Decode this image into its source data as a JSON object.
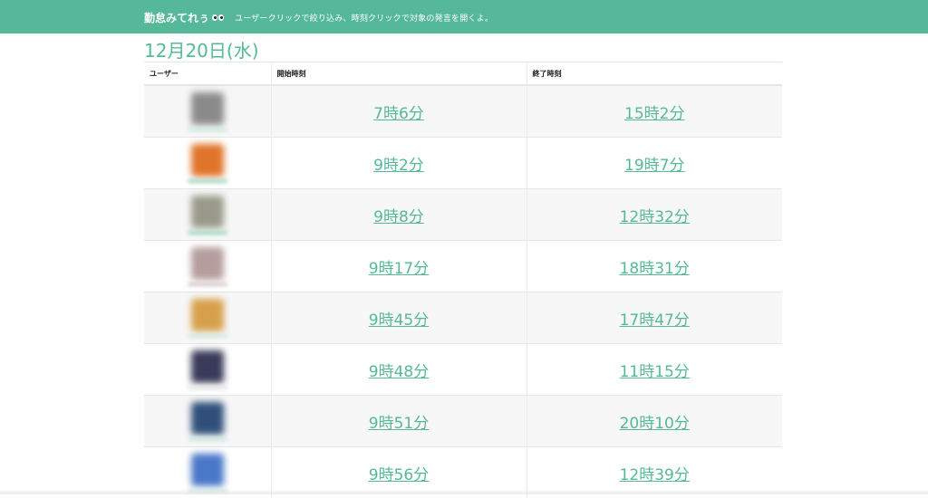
{
  "header": {
    "brand": "勤怠みてれぅ",
    "hint": "ユーザークリックで絞り込み、時刻クリックで対象の発言を開くよ。",
    "color": "#55b999"
  },
  "date_heading": "12月20日(水)",
  "table": {
    "columns": [
      "ユーザー",
      "開始時刻",
      "終了時刻"
    ],
    "rows": [
      {
        "avatar_color": "#8a8a8a",
        "label_color": "#cfe9df",
        "start": "7時6分",
        "end": "15時2分"
      },
      {
        "avatar_color": "#e0742a",
        "label_color": "#9fd9c1",
        "start": "9時2分",
        "end": "19時7分"
      },
      {
        "avatar_color": "#9a9a8a",
        "label_color": "#9fd9c1",
        "start": "9時8分",
        "end": "12時32分"
      },
      {
        "avatar_color": "#b59d9d",
        "label_color": "#d9c9c9",
        "start": "9時17分",
        "end": "18時31分"
      },
      {
        "avatar_color": "#d6a04a",
        "label_color": "#cfe9df",
        "start": "9時45分",
        "end": "17時47分"
      },
      {
        "avatar_color": "#3a3a5a",
        "label_color": "#e6e6e6",
        "start": "9時48分",
        "end": "11時15分"
      },
      {
        "avatar_color": "#2f4f7a",
        "label_color": "#cfe9df",
        "start": "9時51分",
        "end": "20時10分"
      },
      {
        "avatar_color": "#4a78c8",
        "label_color": "#cfe9df",
        "start": "9時56分",
        "end": "12時39分"
      }
    ]
  }
}
